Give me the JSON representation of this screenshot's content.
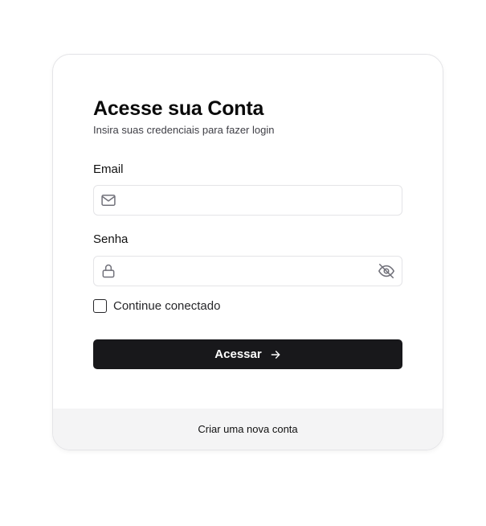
{
  "login": {
    "title": "Acesse sua Conta",
    "subtitle": "Insira suas credenciais para fazer login",
    "email_label": "Email",
    "email_value": "",
    "email_icon": "mail-icon",
    "password_label": "Senha",
    "password_value": "",
    "password_icon": "lock-icon",
    "toggle_visibility_icon": "eye-off-icon",
    "remember_label": "Continue conectado",
    "remember_checked": false,
    "submit_label": "Acessar",
    "submit_icon": "arrow-right-icon",
    "submit_color": "#18181b",
    "footer_link": "Criar uma nova conta"
  }
}
